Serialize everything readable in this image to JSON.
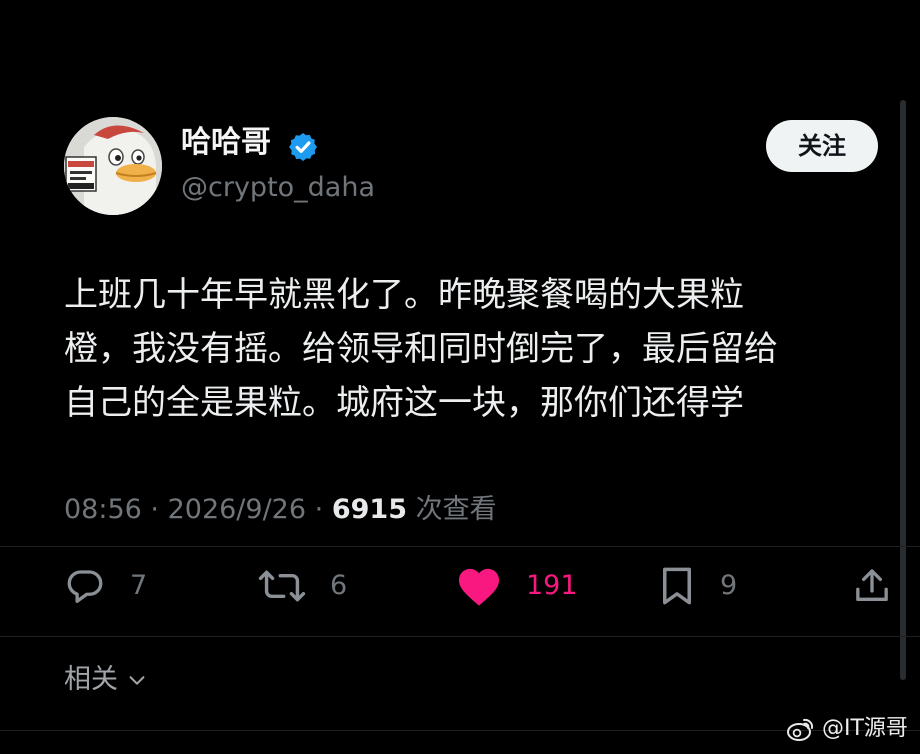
{
  "author": {
    "display_name": "哈哈哥",
    "handle": "@crypto_daha",
    "verified": true
  },
  "follow_button": {
    "label": "关注"
  },
  "post": {
    "lines": [
      "上班几十年早就黑化了。昨晚聚餐喝的大果粒",
      "橙，我没有摇。给领导和同时倒完了，最后留给",
      "自己的全是果粒。城府这一块，那你们还得学"
    ]
  },
  "meta": {
    "time": "08:56",
    "separator": "·",
    "date": "2026/9/26",
    "views": "6915",
    "views_label": "次查看"
  },
  "actions": {
    "replies": "7",
    "reposts": "6",
    "likes": "191",
    "bookmarks": "9"
  },
  "related": {
    "label": "相关"
  },
  "watermark": {
    "text": "@IT源哥"
  },
  "colors": {
    "background": "#000000",
    "like": "#f91880",
    "verified": "#1d9bf0",
    "muted": "#71767b"
  }
}
